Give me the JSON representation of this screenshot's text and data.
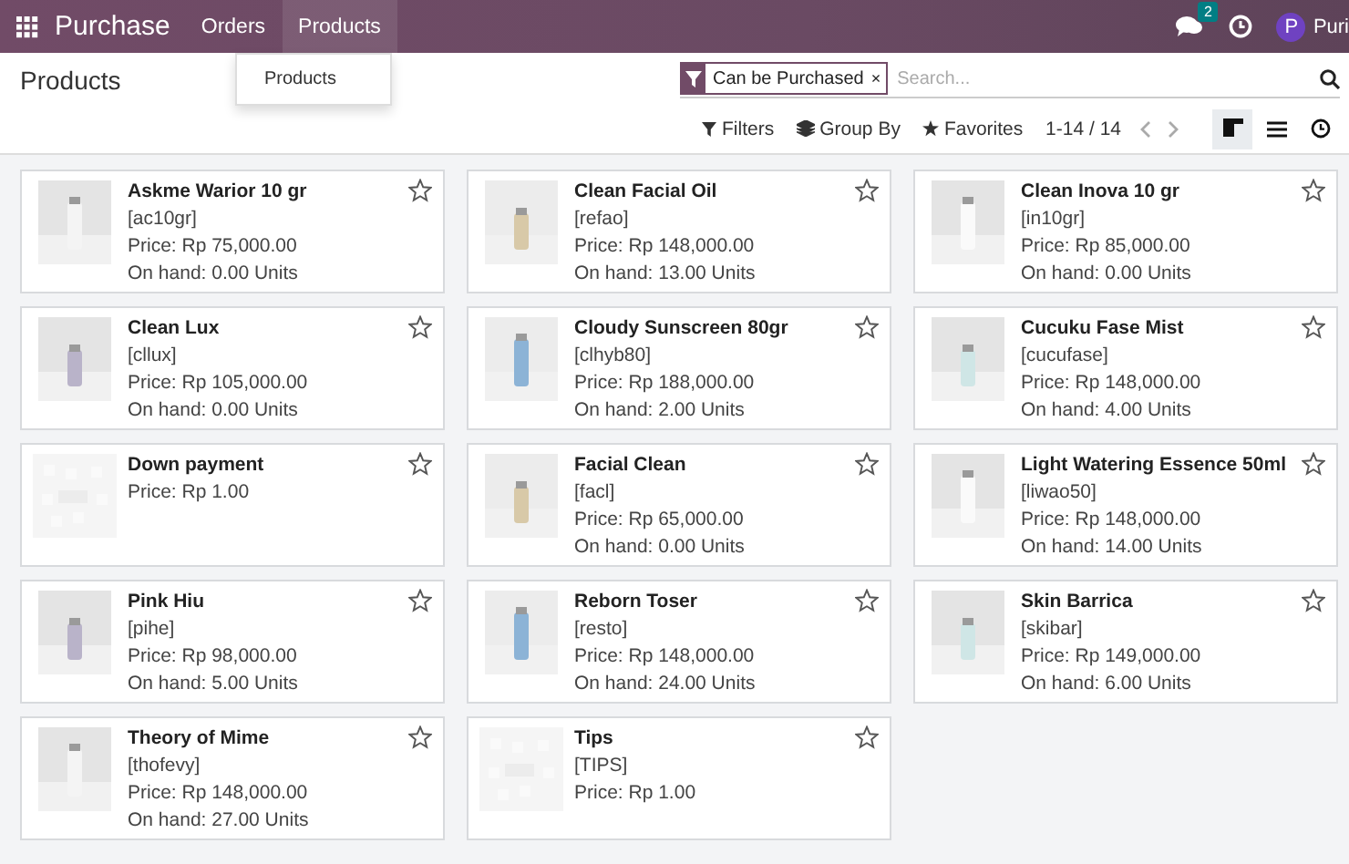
{
  "navbar": {
    "app_name": "Purchase",
    "menu": [
      {
        "label": "Orders",
        "selected": false
      },
      {
        "label": "Products",
        "selected": true
      }
    ],
    "message_count": "2",
    "avatar_letter": "P",
    "user": "Puri"
  },
  "dropdown": {
    "items": [
      "Products"
    ]
  },
  "control_panel": {
    "title": "Products",
    "facet": "Can be Purchased",
    "facet_remove": "×",
    "search": {
      "placeholder": "Search..."
    },
    "buttons": [
      "Filters",
      "Group By",
      "Favorites"
    ],
    "pager": "1-14 / 14",
    "views": [
      {
        "kind": "kanban",
        "selected": true
      },
      {
        "kind": "list",
        "selected": false
      },
      {
        "kind": "activity",
        "selected": false
      }
    ]
  },
  "products": [
    {
      "kind": "picture",
      "name": "Askme Warior 10 gr",
      "code": "[ac10gr]",
      "price": "Price: Rp 75,000.00",
      "on_hand": "On hand: 0.00 Units",
      "favorite": false
    },
    {
      "kind": "picture",
      "name": "Clean Facial Oil",
      "code": "[refao]",
      "price": "Price: Rp 148,000.00",
      "on_hand": "On hand: 13.00 Units",
      "favorite": false
    },
    {
      "kind": "picture",
      "name": "Clean Inova 10 gr",
      "code": "[in10gr]",
      "price": "Price: Rp 85,000.00",
      "on_hand": "On hand: 0.00 Units",
      "favorite": false
    },
    {
      "kind": "picture",
      "name": "Clean Lux",
      "code": "[cllux]",
      "price": "Price: Rp 105,000.00",
      "on_hand": "On hand: 0.00 Units",
      "favorite": false
    },
    {
      "kind": "picture",
      "name": "Cloudy Sunscreen 80gr",
      "code": "[clhyb80]",
      "price": "Price: Rp 188,000.00",
      "on_hand": "On hand: 2.00 Units",
      "favorite": false
    },
    {
      "kind": "picture",
      "name": "Cucuku Fase Mist",
      "code": "[cucufase]",
      "price": "Price: Rp 148,000.00",
      "on_hand": "On hand: 4.00 Units",
      "favorite": false
    },
    {
      "kind": "placeholder",
      "name": "Down payment",
      "price": "Price: Rp 1.00",
      "favorite": false
    },
    {
      "kind": "picture",
      "name": "Facial Clean",
      "code": "[facl]",
      "price": "Price: Rp 65,000.00",
      "on_hand": "On hand: 0.00 Units",
      "favorite": false
    },
    {
      "kind": "picture",
      "name": "Light Watering Essence 50ml",
      "code": "[liwao50]",
      "price": "Price: Rp 148,000.00",
      "on_hand": "On hand: 14.00 Units",
      "favorite": false
    },
    {
      "kind": "picture",
      "name": "Pink Hiu",
      "code": "[pihe]",
      "price": "Price: Rp 98,000.00",
      "on_hand": "On hand: 5.00 Units",
      "favorite": false
    },
    {
      "kind": "picture",
      "name": "Reborn Toser",
      "code": "[resto]",
      "price": "Price: Rp 148,000.00",
      "on_hand": "On hand: 24.00 Units",
      "favorite": false
    },
    {
      "kind": "picture",
      "name": "Skin Barrica",
      "code": "[skibar]",
      "price": "Price: Rp 149,000.00",
      "on_hand": "On hand: 6.00 Units",
      "favorite": false
    },
    {
      "kind": "picture",
      "name": "Theory of Mime",
      "code": "[thofevy]",
      "price": "Price: Rp 148,000.00",
      "on_hand": "On hand: 27.00 Units",
      "favorite": false
    },
    {
      "kind": "placeholder",
      "name": "Tips",
      "code": "[TIPS]",
      "price": "Price: Rp 1.00",
      "favorite": false
    }
  ]
}
